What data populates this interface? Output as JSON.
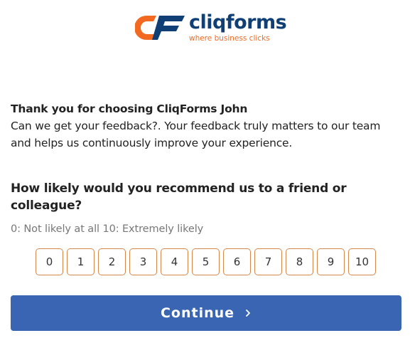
{
  "brand": {
    "name": "cliqforms",
    "tagline": "where business clicks",
    "primary_color": "#0f3f74",
    "accent_color": "#f26a21"
  },
  "intro": {
    "title": "Thank you for choosing CliqForms John",
    "body": "Can we get your feedback?. Your feedback truly matters to our team and helps us continuously improve your experience."
  },
  "question": {
    "text": "How likely would you recommend us to a friend or colleague?",
    "scale_hint": "0: Not likely at all 10: Extremely likely",
    "options": [
      "0",
      "1",
      "2",
      "3",
      "4",
      "5",
      "6",
      "7",
      "8",
      "9",
      "10"
    ]
  },
  "actions": {
    "continue_label": "Continue",
    "continue_icon": "chevron-right-icon",
    "button_color": "#3a65b2"
  }
}
